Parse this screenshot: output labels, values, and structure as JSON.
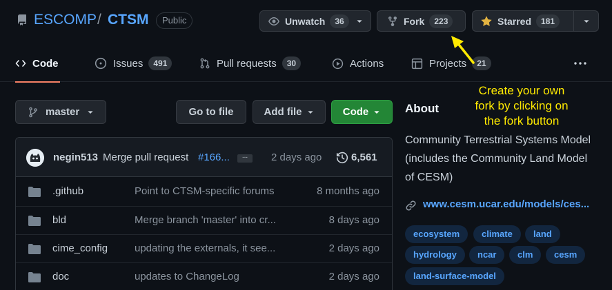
{
  "repo": {
    "owner": "ESCOMP",
    "separator": "/",
    "name": "CTSM",
    "visibility": "Public"
  },
  "actions": {
    "watch_label": "Unwatch",
    "watch_count": "36",
    "fork_label": "Fork",
    "fork_count": "223",
    "star_label": "Starred",
    "star_count": "181"
  },
  "tabs": [
    {
      "label": "Code",
      "count": null,
      "icon": "code-icon"
    },
    {
      "label": "Issues",
      "count": "491",
      "icon": "issue-icon"
    },
    {
      "label": "Pull requests",
      "count": "30",
      "icon": "pull-request-icon"
    },
    {
      "label": "Actions",
      "count": null,
      "icon": "play-icon"
    },
    {
      "label": "Projects",
      "count": "21",
      "icon": "project-icon"
    }
  ],
  "annotation": {
    "lines": [
      "Create your own",
      "fork by clicking on",
      "the fork button"
    ],
    "color": "#ffea00"
  },
  "branch": {
    "name": "master",
    "go_to_file": "Go to file",
    "add_file": "Add file",
    "code": "Code"
  },
  "commit": {
    "author": "negin513",
    "message": "Merge pull request",
    "link": "#166...",
    "ellipsis": "...",
    "time": "2 days ago",
    "commit_count": "6,561"
  },
  "files": [
    {
      "name": ".github",
      "message": "Point to CTSM-specific forums",
      "time": "8 months ago"
    },
    {
      "name": "bld",
      "message": "Merge branch 'master' into cr...",
      "time": "8 days ago"
    },
    {
      "name": "cime_config",
      "message": "updating the externals, it see...",
      "time": "2 days ago"
    },
    {
      "name": "doc",
      "message": "updates to ChangeLog",
      "time": "2 days ago"
    }
  ],
  "about": {
    "heading": "About",
    "description": "Community Terrestrial Systems Model (includes the Community Land Model of CESM)",
    "link": "www.cesm.ucar.edu/models/ces...",
    "topics": [
      "ecosystem",
      "climate",
      "land",
      "hydrology",
      "ncar",
      "clm",
      "cesm",
      "land-surface-model"
    ]
  },
  "colors": {
    "background": "#0d1117",
    "link": "#58a6ff",
    "primary_button": "#238636",
    "tab_underline": "#f78166"
  }
}
